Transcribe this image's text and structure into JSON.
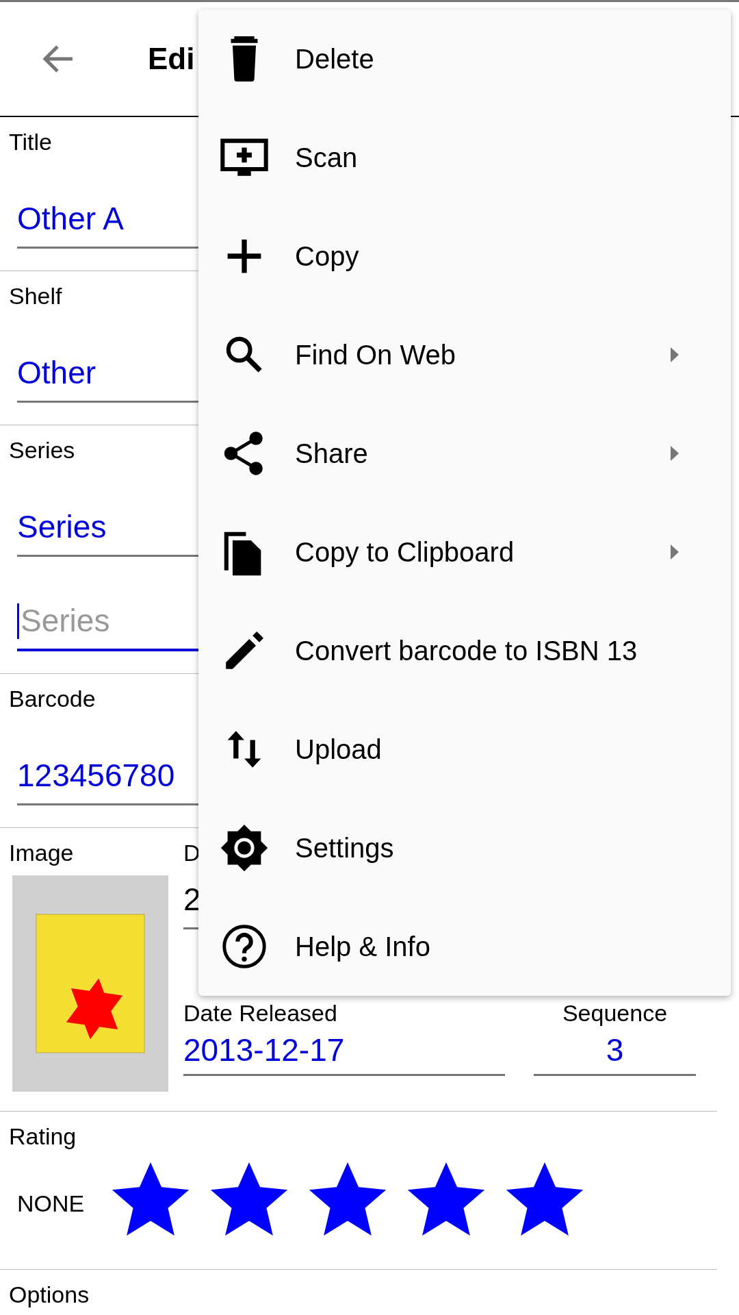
{
  "header": {
    "title": "Edi"
  },
  "sections": [
    {
      "label": "Title",
      "inputs": [
        {
          "value": "Other A",
          "focused": false
        }
      ]
    },
    {
      "label": "Shelf",
      "inputs": [
        {
          "value": "Other",
          "focused": false
        }
      ]
    },
    {
      "label": "Series",
      "inputs": [
        {
          "value": "Series",
          "focused": false
        },
        {
          "placeholder": "Series",
          "focused": true
        }
      ]
    },
    {
      "label": "Barcode",
      "inputs": [
        {
          "value": "123456780",
          "focused": false
        }
      ]
    }
  ],
  "image_section": {
    "label": "Image",
    "date_label": "D",
    "date_value": "2",
    "released_label": "Date Released",
    "released_value": "2013-12-17",
    "sequence_label": "Sequence",
    "sequence_value": "3"
  },
  "rating": {
    "label": "Rating",
    "none_label": "NONE",
    "stars": 5
  },
  "options": {
    "label": "Options"
  },
  "menu": {
    "items": [
      {
        "label": "Delete",
        "has_submenu": false
      },
      {
        "label": "Scan",
        "has_submenu": false
      },
      {
        "label": "Copy",
        "has_submenu": false
      },
      {
        "label": "Find On Web",
        "has_submenu": true
      },
      {
        "label": "Share",
        "has_submenu": true
      },
      {
        "label": "Copy to Clipboard",
        "has_submenu": true
      },
      {
        "label": "Convert barcode to ISBN 13",
        "has_submenu": false
      },
      {
        "label": "Upload",
        "has_submenu": false
      },
      {
        "label": "Settings",
        "has_submenu": false
      },
      {
        "label": "Help & Info",
        "has_submenu": false
      }
    ]
  }
}
